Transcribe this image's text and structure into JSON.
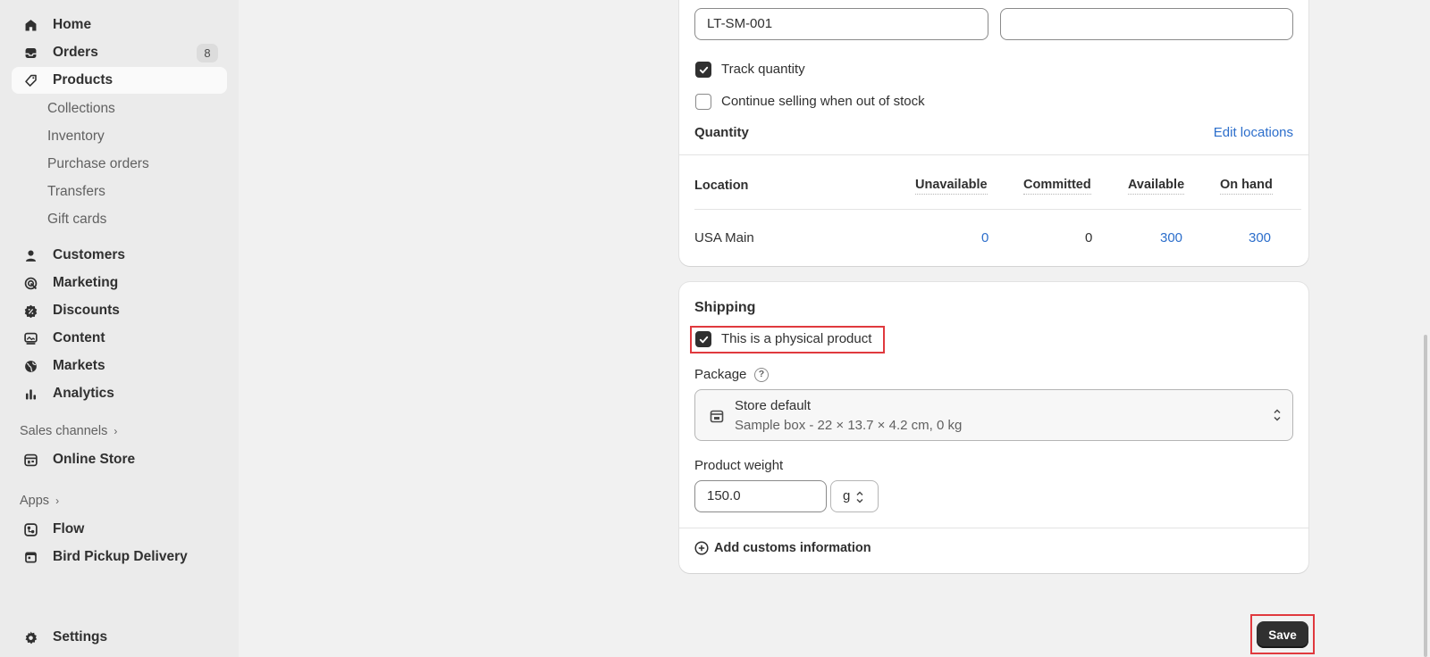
{
  "sidebar": {
    "items": [
      {
        "label": "Home",
        "icon": "home-icon"
      },
      {
        "label": "Orders",
        "icon": "inbox-icon",
        "badge": "8"
      },
      {
        "label": "Products",
        "icon": "tag-icon",
        "active": true
      },
      {
        "label": "Customers",
        "icon": "person-icon"
      },
      {
        "label": "Marketing",
        "icon": "target-icon"
      },
      {
        "label": "Discounts",
        "icon": "discount-icon"
      },
      {
        "label": "Content",
        "icon": "image-icon"
      },
      {
        "label": "Markets",
        "icon": "globe-icon"
      },
      {
        "label": "Analytics",
        "icon": "bar-chart-icon"
      }
    ],
    "product_subitems": [
      "Collections",
      "Inventory",
      "Purchase orders",
      "Transfers",
      "Gift cards"
    ],
    "sales_channels_label": "Sales channels",
    "online_store_label": "Online Store",
    "apps_label": "Apps",
    "apps": [
      {
        "label": "Flow",
        "icon": "flow-icon"
      },
      {
        "label": "Bird Pickup Delivery",
        "icon": "calendar-icon"
      }
    ],
    "settings_label": "Settings"
  },
  "inventory": {
    "sku_value": "LT-SM-001",
    "barcode_value": "",
    "track_quantity_label": "Track quantity",
    "track_quantity_checked": true,
    "continue_selling_label": "Continue selling when out of stock",
    "continue_selling_checked": false,
    "quantity_heading": "Quantity",
    "edit_locations_label": "Edit locations",
    "table": {
      "headers": [
        "Location",
        "Unavailable",
        "Committed",
        "Available",
        "On hand"
      ],
      "rows": [
        {
          "location": "USA Main",
          "unavailable": "0",
          "committed": "0",
          "available": "300",
          "on_hand": "300"
        }
      ]
    }
  },
  "shipping": {
    "heading": "Shipping",
    "physical_label": "This is a physical product",
    "physical_checked": true,
    "package_label": "Package",
    "package_name": "Store default",
    "package_detail": "Sample box - 22 × 13.7 × 4.2 cm, 0 kg",
    "weight_label": "Product weight",
    "weight_value": "150.0",
    "weight_unit": "g",
    "customs_label": "Add customs information"
  },
  "actions": {
    "save_label": "Save"
  },
  "colors": {
    "accent_link": "#2c6ecb",
    "highlight": "#e0393e",
    "primary_button": "#303030"
  }
}
